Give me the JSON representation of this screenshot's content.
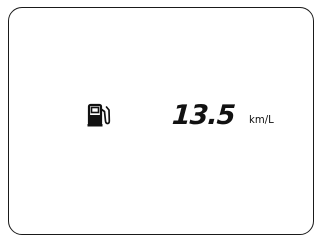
{
  "display": {
    "icon": "fuel-pump-icon",
    "fuel_economy": {
      "value": "13.5",
      "unit": "km/L"
    }
  },
  "colors": {
    "background": "#ffffff",
    "segment": "#111111",
    "border": "#1a1a1a"
  }
}
